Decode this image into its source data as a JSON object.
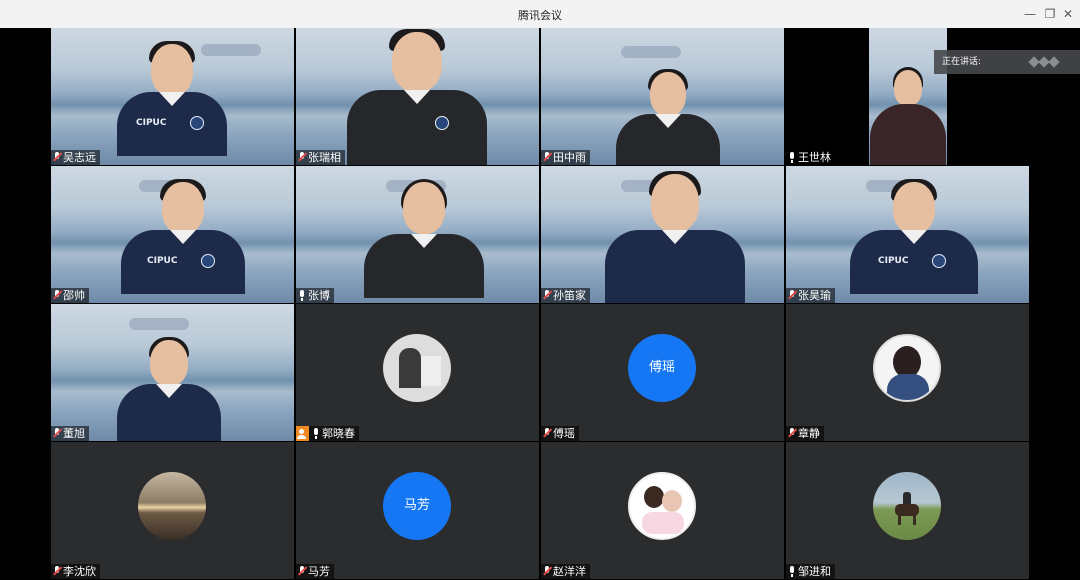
{
  "window": {
    "title": "腾讯会议"
  },
  "speaking_banner": {
    "label": "正在讲话:"
  },
  "participants": [
    {
      "name": "吴志远",
      "mic": "muted",
      "kind": "video"
    },
    {
      "name": "张瑞相",
      "mic": "muted",
      "kind": "video"
    },
    {
      "name": "田中雨",
      "mic": "muted",
      "kind": "video"
    },
    {
      "name": "王世林",
      "mic": "on",
      "kind": "video"
    },
    {
      "name": "邵帅",
      "mic": "muted",
      "kind": "video"
    },
    {
      "name": "张博",
      "mic": "on",
      "kind": "video"
    },
    {
      "name": "孙笛家",
      "mic": "muted",
      "kind": "video"
    },
    {
      "name": "张昊瑜",
      "mic": "muted",
      "kind": "video"
    },
    {
      "name": "董旭",
      "mic": "muted",
      "kind": "video"
    },
    {
      "name": "郭晓春",
      "mic": "on",
      "kind": "avatar",
      "host": true
    },
    {
      "name": "傅瑶",
      "mic": "muted",
      "kind": "avatar",
      "avatar_text": "傅瑶",
      "avatar_color": "#1677f4"
    },
    {
      "name": "章静",
      "mic": "muted",
      "kind": "avatar"
    },
    {
      "name": "李沈欣",
      "mic": "muted",
      "kind": "avatar"
    },
    {
      "name": "马芳",
      "mic": "muted",
      "kind": "avatar",
      "avatar_text": "马芳",
      "avatar_color": "#1677f4"
    },
    {
      "name": "赵洋洋",
      "mic": "muted",
      "kind": "avatar"
    },
    {
      "name": "邹进和",
      "mic": "on",
      "kind": "avatar"
    }
  ],
  "icons": {
    "mic": "mic-icon",
    "mic_muted": "mic-muted-icon",
    "host": "host-icon"
  }
}
